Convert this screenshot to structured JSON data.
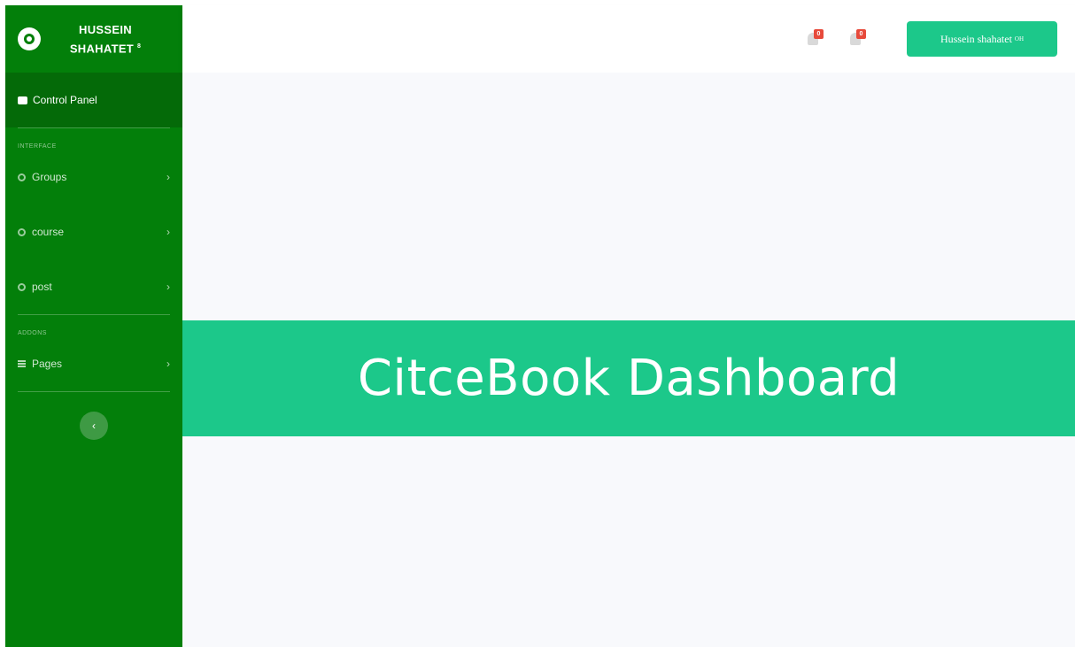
{
  "brand": {
    "name_line1": "HUSSEIN",
    "name_line2": "SHAHATET",
    "name_sup": "8"
  },
  "sidebar": {
    "active_item": {
      "label": "Control Panel",
      "icon": "dashboard-icon"
    },
    "sections": [
      {
        "heading": "INTERFACE",
        "items": [
          {
            "label": "Groups",
            "icon": "gear-icon"
          },
          {
            "label": "course",
            "icon": "gear-icon"
          },
          {
            "label": "post",
            "icon": "gear-icon"
          }
        ]
      },
      {
        "heading": "ADDONS",
        "items": [
          {
            "label": "Pages",
            "icon": "grid-icon"
          }
        ]
      }
    ],
    "toggle_glyph": "‹"
  },
  "topbar": {
    "alerts": [
      {
        "badge": "0",
        "icon": "bell-icon"
      },
      {
        "badge": "0",
        "icon": "envelope-icon"
      }
    ],
    "user_name": "Hussein shahatet",
    "user_sup": "OH"
  },
  "banner": {
    "title": "CitceBook Dashboard"
  },
  "colors": {
    "sidebar": "#037f0a",
    "sidebar_active": "#046a08",
    "accent": "#1cc88a",
    "badge": "#e74a3b",
    "content_bg": "#f8f9fc"
  }
}
